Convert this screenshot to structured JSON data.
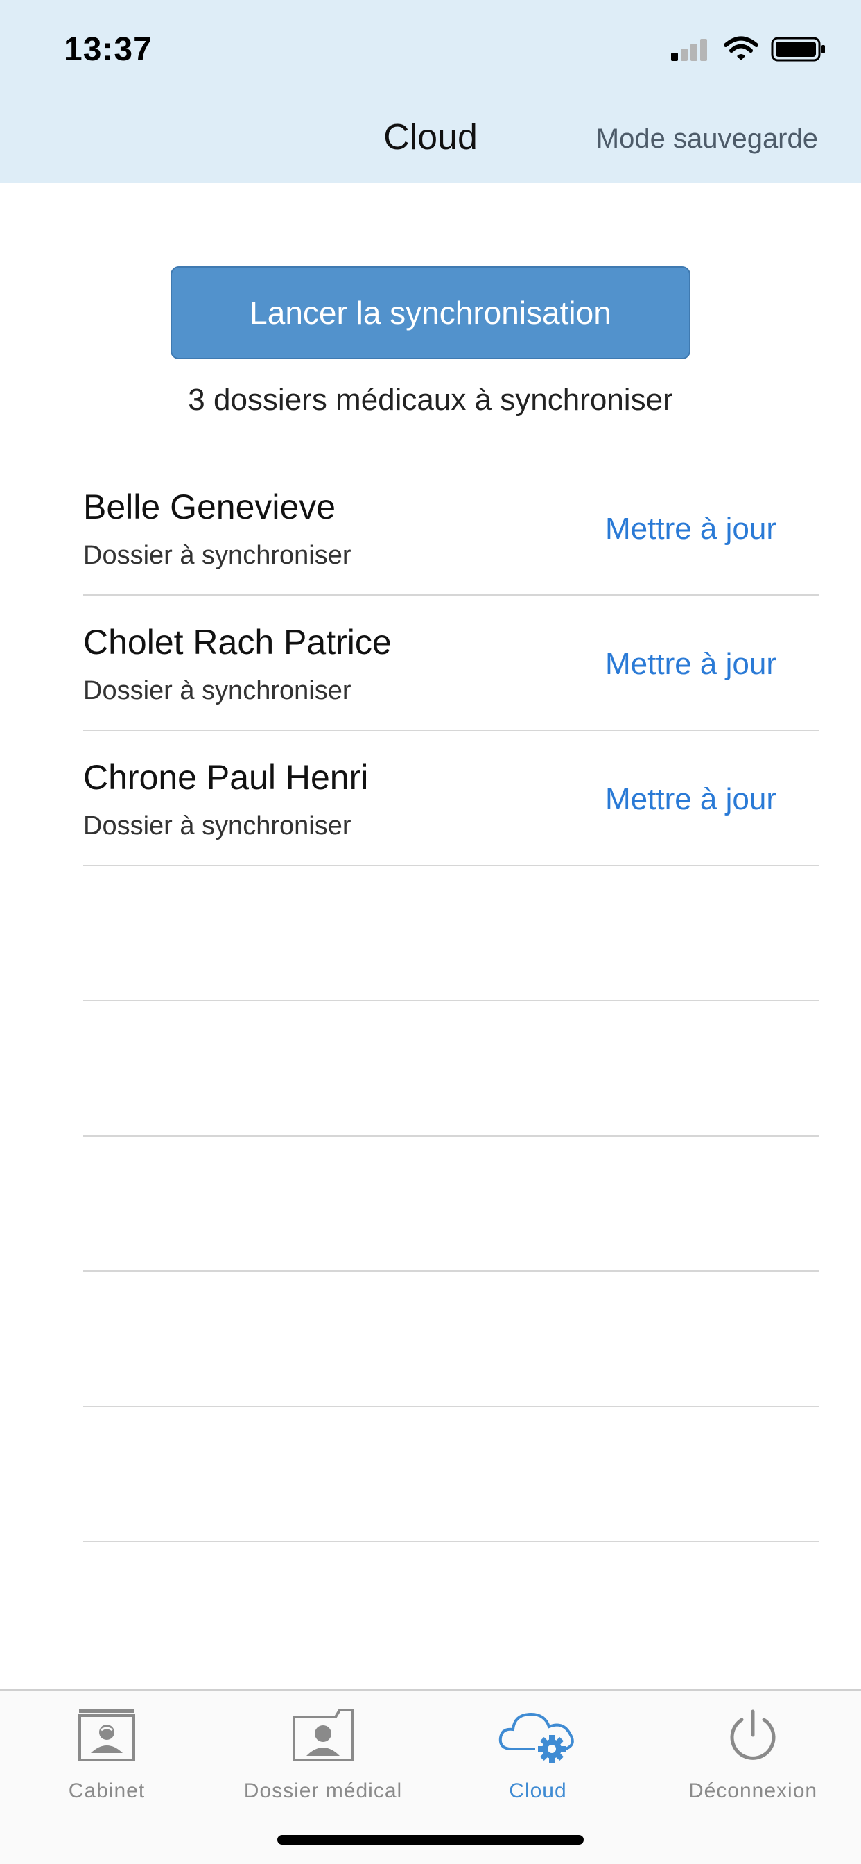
{
  "status": {
    "time": "13:37"
  },
  "nav": {
    "title": "Cloud",
    "right_action": "Mode sauvegarde"
  },
  "sync": {
    "button_label": "Lancer la synchronisation",
    "count_text": "3 dossiers médicaux à synchroniser"
  },
  "records": [
    {
      "name": "Belle Genevieve",
      "status": "Dossier à synchroniser",
      "action": "Mettre à jour"
    },
    {
      "name": "Cholet Rach Patrice",
      "status": "Dossier à synchroniser",
      "action": "Mettre à jour"
    },
    {
      "name": "Chrone Paul Henri",
      "status": "Dossier à synchroniser",
      "action": "Mettre à jour"
    }
  ],
  "tabs": [
    {
      "label": "Cabinet",
      "icon": "cabinet-icon",
      "active": false
    },
    {
      "label": "Dossier médical",
      "icon": "medical-folder-icon",
      "active": false
    },
    {
      "label": "Cloud",
      "icon": "cloud-gear-icon",
      "active": true
    },
    {
      "label": "Déconnexion",
      "icon": "power-icon",
      "active": false
    }
  ],
  "colors": {
    "header_bg": "#deedf7",
    "accent": "#5292cc",
    "link": "#2a7ad6",
    "tab_active": "#3f8bd3",
    "tab_inactive": "#8a8a8a"
  }
}
